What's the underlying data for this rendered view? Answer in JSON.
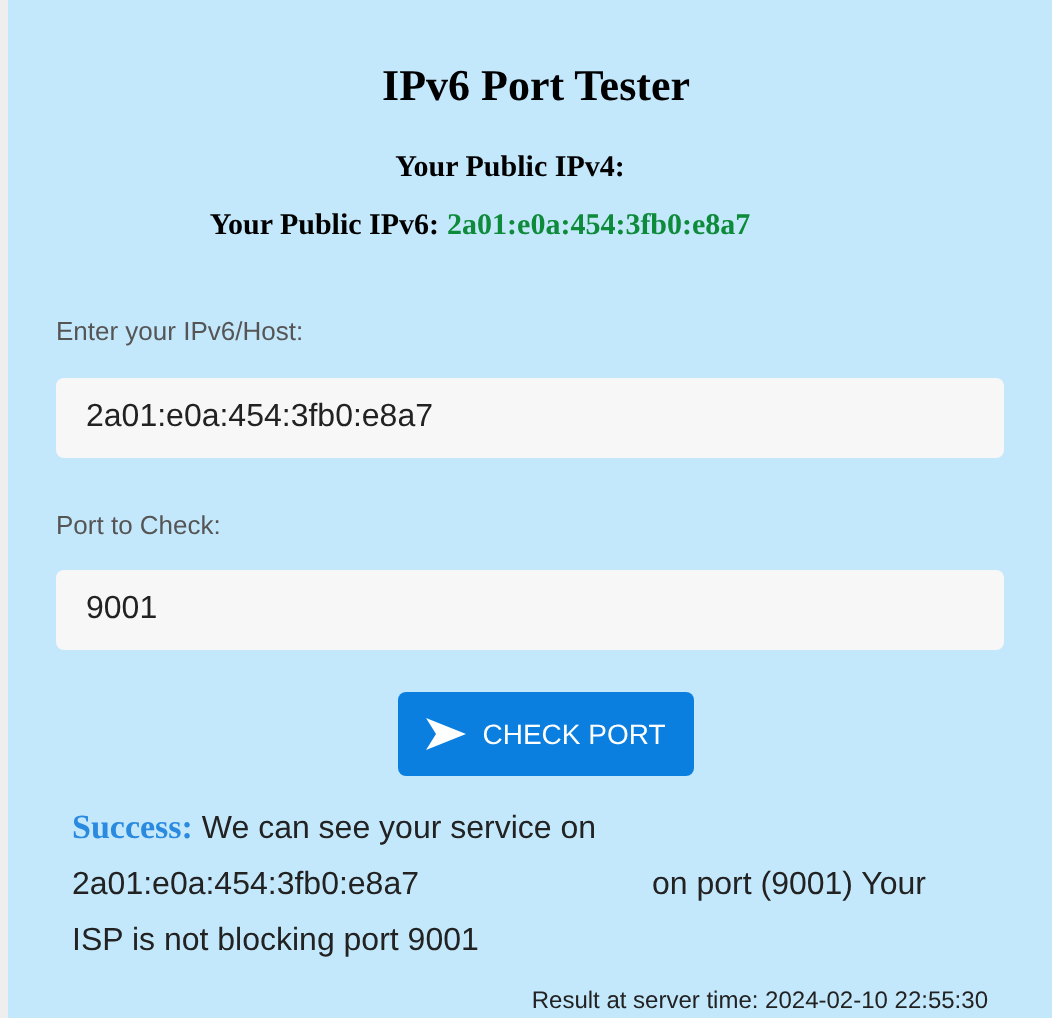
{
  "title": "IPv6 Port Tester",
  "public_ipv4": {
    "label": "Your Public IPv4:"
  },
  "public_ipv6": {
    "label": "Your Public IPv6:",
    "value": "2a01:e0a:454:3fb0:e8a7"
  },
  "fields": [
    {
      "label": "Enter your IPv6/Host:",
      "value": "2a01:e0a:454:3fb0:e8a7"
    },
    {
      "label": "Port to Check:",
      "value": "9001"
    }
  ],
  "button": {
    "label": "CHECK PORT"
  },
  "result": {
    "status": "Success:",
    "text_before": "We can see your service on",
    "address": "2a01:e0a:454:3fb0:e8a7",
    "text_after": "on port (9001) Your ISP is not blocking port 9001"
  },
  "server_time": "Result at server time: 2024-02-10 22:55:30"
}
